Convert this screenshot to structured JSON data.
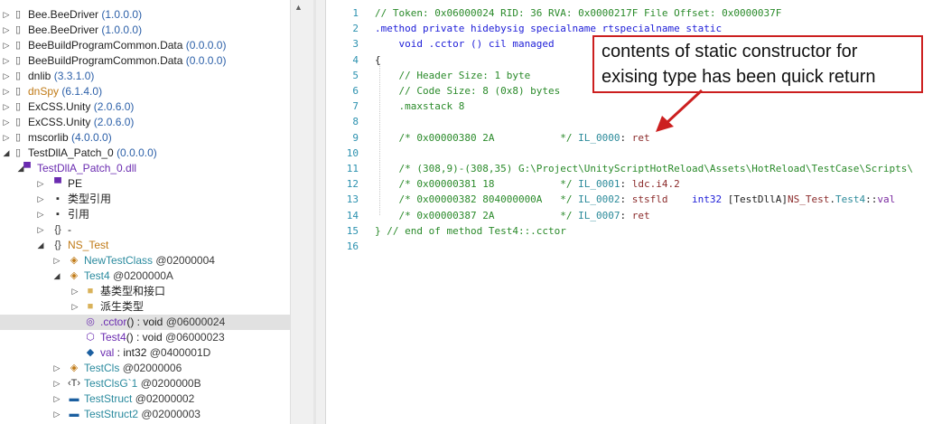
{
  "tree": {
    "rows": [
      {
        "name": "Bee.BeeDriver",
        "version": "(1.0.0.0)",
        "icon": "assembly-icon",
        "expander": "collapsed"
      },
      {
        "name": "Bee.BeeDriver",
        "version": "(1.0.0.0)",
        "icon": "assembly-icon",
        "expander": "collapsed"
      },
      {
        "name": "BeeBuildProgramCommon.Data",
        "version": "(0.0.0.0)",
        "icon": "assembly-icon",
        "expander": "collapsed"
      },
      {
        "name": "BeeBuildProgramCommon.Data",
        "version": "(0.0.0.0)",
        "icon": "assembly-icon",
        "expander": "collapsed"
      },
      {
        "name": "dnlib",
        "version": "(3.3.1.0)",
        "icon": "assembly-icon",
        "expander": "collapsed"
      },
      {
        "name": "dnSpy",
        "version": "(6.1.4.0)",
        "icon": "assembly-icon",
        "expander": "collapsed"
      },
      {
        "name": "ExCSS.Unity",
        "version": "(2.0.6.0)",
        "icon": "assembly-icon",
        "expander": "collapsed"
      },
      {
        "name": "ExCSS.Unity",
        "version": "(2.0.6.0)",
        "icon": "assembly-icon",
        "expander": "collapsed"
      },
      {
        "name": "mscorlib",
        "version": "(4.0.0.0)",
        "icon": "assembly-icon",
        "expander": "collapsed"
      },
      {
        "name": "TestDllA_Patch_0",
        "version": "(0.0.0.0)",
        "icon": "assembly-icon",
        "expander": "expanded"
      },
      {
        "name": "TestDllA_Patch_0.dll",
        "icon": "module-icon",
        "expander": "expanded"
      },
      {
        "name": "PE",
        "icon": "pe-icon",
        "expander": "collapsed"
      },
      {
        "name": "类型引用",
        "icon": "type-reference-icon",
        "expander": "collapsed"
      },
      {
        "name": "引用",
        "icon": "reference-icon",
        "expander": "collapsed"
      },
      {
        "name": "-",
        "icon": "namespace-icon",
        "expander": "collapsed"
      },
      {
        "name": "NS_Test",
        "icon": "namespace-icon",
        "expander": "expanded"
      },
      {
        "name": "NewTestClass",
        "token": "@02000004",
        "icon": "class-icon",
        "expander": "collapsed"
      },
      {
        "name": "Test4",
        "token": "@0200000A",
        "icon": "class-icon",
        "expander": "expanded"
      },
      {
        "name": "基类型和接口",
        "icon": "folder-icon",
        "expander": "collapsed"
      },
      {
        "name": "派生类型",
        "icon": "folder-icon",
        "expander": "collapsed"
      },
      {
        "name": ".cctor",
        "sig": "() : void",
        "token": "@06000024",
        "icon": "static-method-icon"
      },
      {
        "name": "Test4",
        "sig": "() : void",
        "token": "@06000023",
        "icon": "method-icon"
      },
      {
        "name": "val",
        "sig": " : int32",
        "token": "@0400001D",
        "icon": "field-icon"
      },
      {
        "name": "TestCls",
        "token": "@02000006",
        "icon": "class-icon",
        "expander": "collapsed"
      },
      {
        "name": "TestClsG`1",
        "token": "@0200000B",
        "icon": "generic-class-icon",
        "expander": "collapsed"
      },
      {
        "name": "TestStruct",
        "token": "@02000002",
        "icon": "struct-icon",
        "expander": "collapsed"
      },
      {
        "name": "TestStruct2",
        "token": "@02000003",
        "icon": "struct-icon",
        "expander": "collapsed"
      }
    ]
  },
  "editor": {
    "line_numbers": [
      "1",
      "2",
      "3",
      "4",
      "5",
      "6",
      "7",
      "8",
      "9",
      "10",
      "11",
      "12",
      "13",
      "14",
      "15",
      "16"
    ],
    "lines": [
      [
        {
          "t": "// Token: 0x06000024 RID: 36 RVA: 0x0000217F File Offset: 0x0000037F",
          "c": "k-green"
        }
      ],
      [
        {
          "t": ".method private hidebysig specialname rtspecialname static",
          "c": "k-blue"
        }
      ],
      [
        {
          "t": "    void .cctor () cil managed",
          "c": "k-blue"
        }
      ],
      [
        {
          "t": "{",
          "c": ""
        }
      ],
      [
        {
          "t": "    // Header Size: 1 byte",
          "c": "k-green"
        }
      ],
      [
        {
          "t": "    // Code Size: 8 (0x8) bytes",
          "c": "k-green"
        }
      ],
      [
        {
          "t": "    .maxstack 8",
          "c": "k-green"
        }
      ],
      [
        {
          "t": "",
          "c": ""
        }
      ],
      [
        {
          "t": "    /* 0x00000380 2A           */ ",
          "c": "k-green"
        },
        {
          "t": "IL_0000",
          "c": "k-teal"
        },
        {
          "t": ": ",
          "c": ""
        },
        {
          "t": "ret",
          "c": "k-brown"
        }
      ],
      [
        {
          "t": "",
          "c": ""
        }
      ],
      [
        {
          "t": "    /* (308,9)-(308,35) G:\\Project\\UnityScriptHotReload\\Assets\\HotReload\\TestCase\\Scripts\\",
          "c": "k-green"
        }
      ],
      [
        {
          "t": "    /* 0x00000381 18           */ ",
          "c": "k-green"
        },
        {
          "t": "IL_0001",
          "c": "k-teal"
        },
        {
          "t": ": ",
          "c": ""
        },
        {
          "t": "ldc.i4.2",
          "c": "k-brown"
        }
      ],
      [
        {
          "t": "    /* 0x00000382 804000000A   */ ",
          "c": "k-green"
        },
        {
          "t": "IL_0002",
          "c": "k-teal"
        },
        {
          "t": ": ",
          "c": ""
        },
        {
          "t": "stsfld",
          "c": "k-brown"
        },
        {
          "t": "    ",
          "c": ""
        },
        {
          "t": "int32",
          "c": "k-blue"
        },
        {
          "t": " [TestDllA]",
          "c": ""
        },
        {
          "t": "NS_Test",
          "c": "k-brown"
        },
        {
          "t": ".",
          "c": ""
        },
        {
          "t": "Test4",
          "c": "k-teal"
        },
        {
          "t": "::",
          "c": ""
        },
        {
          "t": "val",
          "c": "k-purple"
        }
      ],
      [
        {
          "t": "    /* 0x00000387 2A           */ ",
          "c": "k-green"
        },
        {
          "t": "IL_0007",
          "c": "k-teal"
        },
        {
          "t": ": ",
          "c": ""
        },
        {
          "t": "ret",
          "c": "k-brown"
        }
      ],
      [
        {
          "t": "} // end of method Test4::.cctor",
          "c": "k-green"
        }
      ],
      [
        {
          "t": "",
          "c": ""
        }
      ]
    ]
  },
  "annotation": {
    "line1": "contents of static constructor for",
    "line2": "exising type has been quick return",
    "color": "#cc1f1f"
  },
  "colors": {
    "selection": "#e1e1e1",
    "line_number": "#2b91af",
    "comment": "#2a8a2a",
    "keyword": "#2020d8"
  }
}
